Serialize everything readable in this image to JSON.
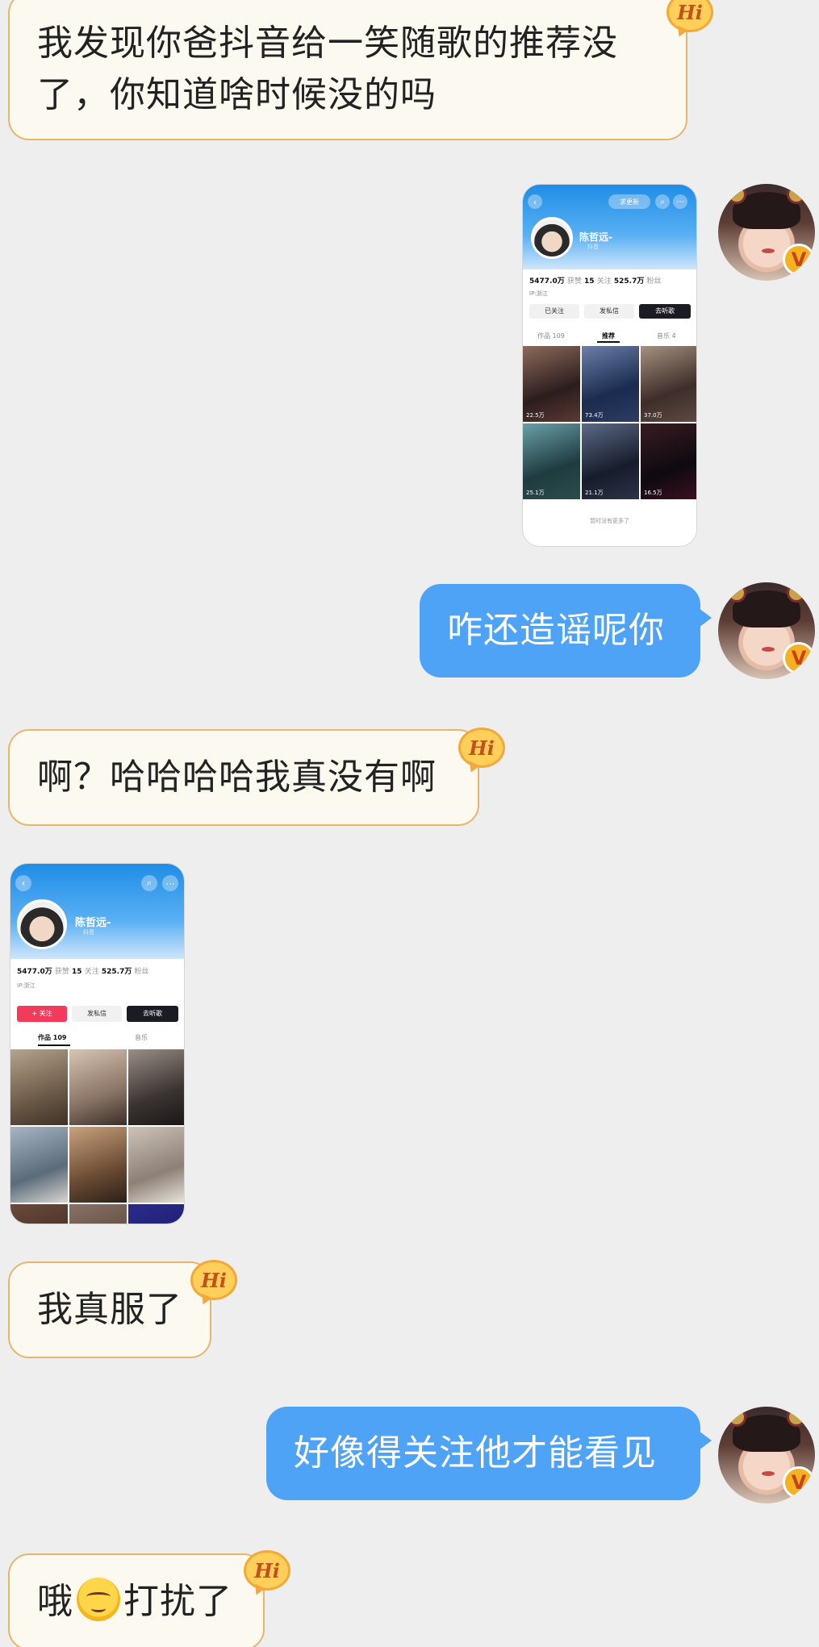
{
  "messages": [
    {
      "side": "in",
      "text_line1": "我发现你爸抖音给一笑随歌的推荐没",
      "text_line2": "了，你知道啥时候没的吗",
      "badge": "Hi"
    },
    {
      "side": "out",
      "type": "image"
    },
    {
      "side": "out",
      "text": "咋还造谣呢你"
    },
    {
      "side": "in",
      "text": "啊？哈哈哈哈我真没有啊",
      "badge": "Hi"
    },
    {
      "side": "in",
      "type": "image"
    },
    {
      "side": "in",
      "text": "我真服了",
      "badge": "Hi"
    },
    {
      "side": "out",
      "text": "好像得关注他才能看见"
    },
    {
      "side": "in",
      "text_before": "哦",
      "emoji": "rolling-eyes-emoji",
      "text_after": "打扰了",
      "badge": "Hi"
    }
  ],
  "shot1": {
    "pill": "求更新",
    "name": "陈哲远-",
    "sub": "抖音",
    "stat1_val": "5477.0万",
    "stat1_lbl": "获赞",
    "stat2_val": "15",
    "stat2_lbl": "关注",
    "stat3_val": "525.7万",
    "stat3_lbl": "粉丝",
    "tags": "IP:浙江",
    "btn1": "已关注",
    "btn2": "发私信",
    "btn3": "去听歌",
    "tab1": "作品 109",
    "tab2": "推荐",
    "tab3": "音乐 4",
    "counts": [
      "22.5万",
      "73.4万",
      "37.0万",
      "25.1万",
      "21.1万",
      "16.5万"
    ],
    "footer": "暂时没有更多了"
  },
  "shot2": {
    "name": "陈哲远-",
    "sub": "抖音",
    "stat1_val": "5477.0万",
    "stat1_lbl": "获赞",
    "stat2_val": "15",
    "stat2_lbl": "关注",
    "stat3_val": "525.7万",
    "stat3_lbl": "粉丝",
    "tags": "IP:浙江",
    "btn1": "+ 关注",
    "btn2": "发私信",
    "btn3": "去听歌",
    "tab1": "作品 109",
    "tab2": "音乐"
  },
  "colors": {
    "incoming_bg": "#fbf9f0",
    "incoming_border": "#e7b66c",
    "outgoing_bg": "#4fa3f7",
    "badge": "#ffcf5a"
  }
}
